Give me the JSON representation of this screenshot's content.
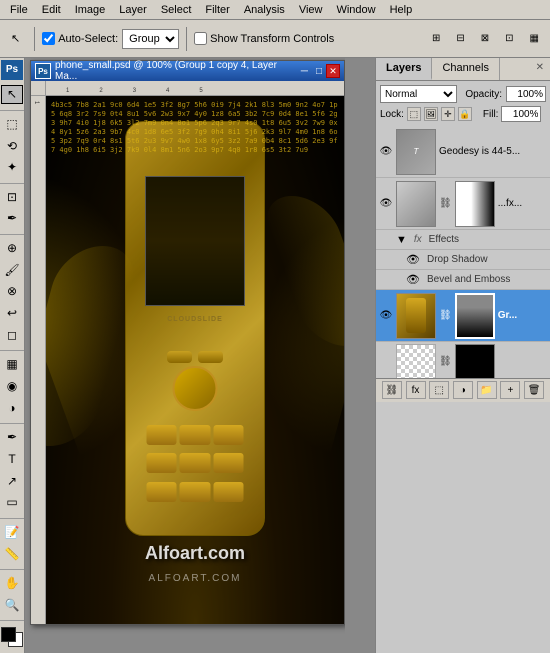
{
  "menubar": {
    "items": [
      "File",
      "Edit",
      "Image",
      "Layer",
      "Select",
      "Filter",
      "Analysis",
      "View",
      "Window",
      "Help"
    ]
  },
  "toolbar": {
    "autoselect_label": "Auto-Select:",
    "autoselect_value": "Group",
    "transform_controls_label": "Show Transform Controls",
    "transform_checked": true
  },
  "document": {
    "title": "phone_small.psd @ 100% (Group 1 copy 4, Layer Ma...",
    "ps_logo": "Ps"
  },
  "layers_panel": {
    "tabs": [
      "Layers",
      "Channels"
    ],
    "active_tab": "Layers",
    "blend_mode": "Normal",
    "opacity_label": "Opacity:",
    "opacity_value": "100%",
    "lock_label": "Lock:",
    "fill_label": "Fill:",
    "fill_value": "100%",
    "layers": [
      {
        "id": 1,
        "name": "Geodesy is 44-5...",
        "visible": true,
        "selected": false,
        "has_thumb": true,
        "has_mask": false,
        "thumb_type": "text_layer"
      },
      {
        "id": 2,
        "name": "...fx...",
        "visible": true,
        "selected": false,
        "has_thumb": true,
        "has_mask": true,
        "thumb_type": "gradient_mask"
      },
      {
        "id": 3,
        "name": "Effects",
        "visible": true,
        "selected": false,
        "is_effects": true,
        "sub_layers": [
          "Drop Shadow",
          "Bevel and Emboss"
        ]
      },
      {
        "id": 4,
        "name": "Gr...",
        "visible": true,
        "selected": true,
        "has_thumb": true,
        "has_mask": true,
        "thumb_type": "phone_layer"
      }
    ],
    "bottom_buttons": [
      "link",
      "fx",
      "mask",
      "adjustment",
      "group",
      "new",
      "delete"
    ]
  },
  "watermark": "Alfoart.com",
  "watermark2": "ALFOART.COM",
  "tools": {
    "items": [
      "move",
      "marquee",
      "lasso",
      "wand",
      "crop",
      "eyedropper",
      "healing",
      "brush",
      "clone",
      "history",
      "eraser",
      "gradient",
      "blur",
      "dodge",
      "pen",
      "type",
      "path-select",
      "shape",
      "notes",
      "measure",
      "hand",
      "zoom"
    ]
  }
}
